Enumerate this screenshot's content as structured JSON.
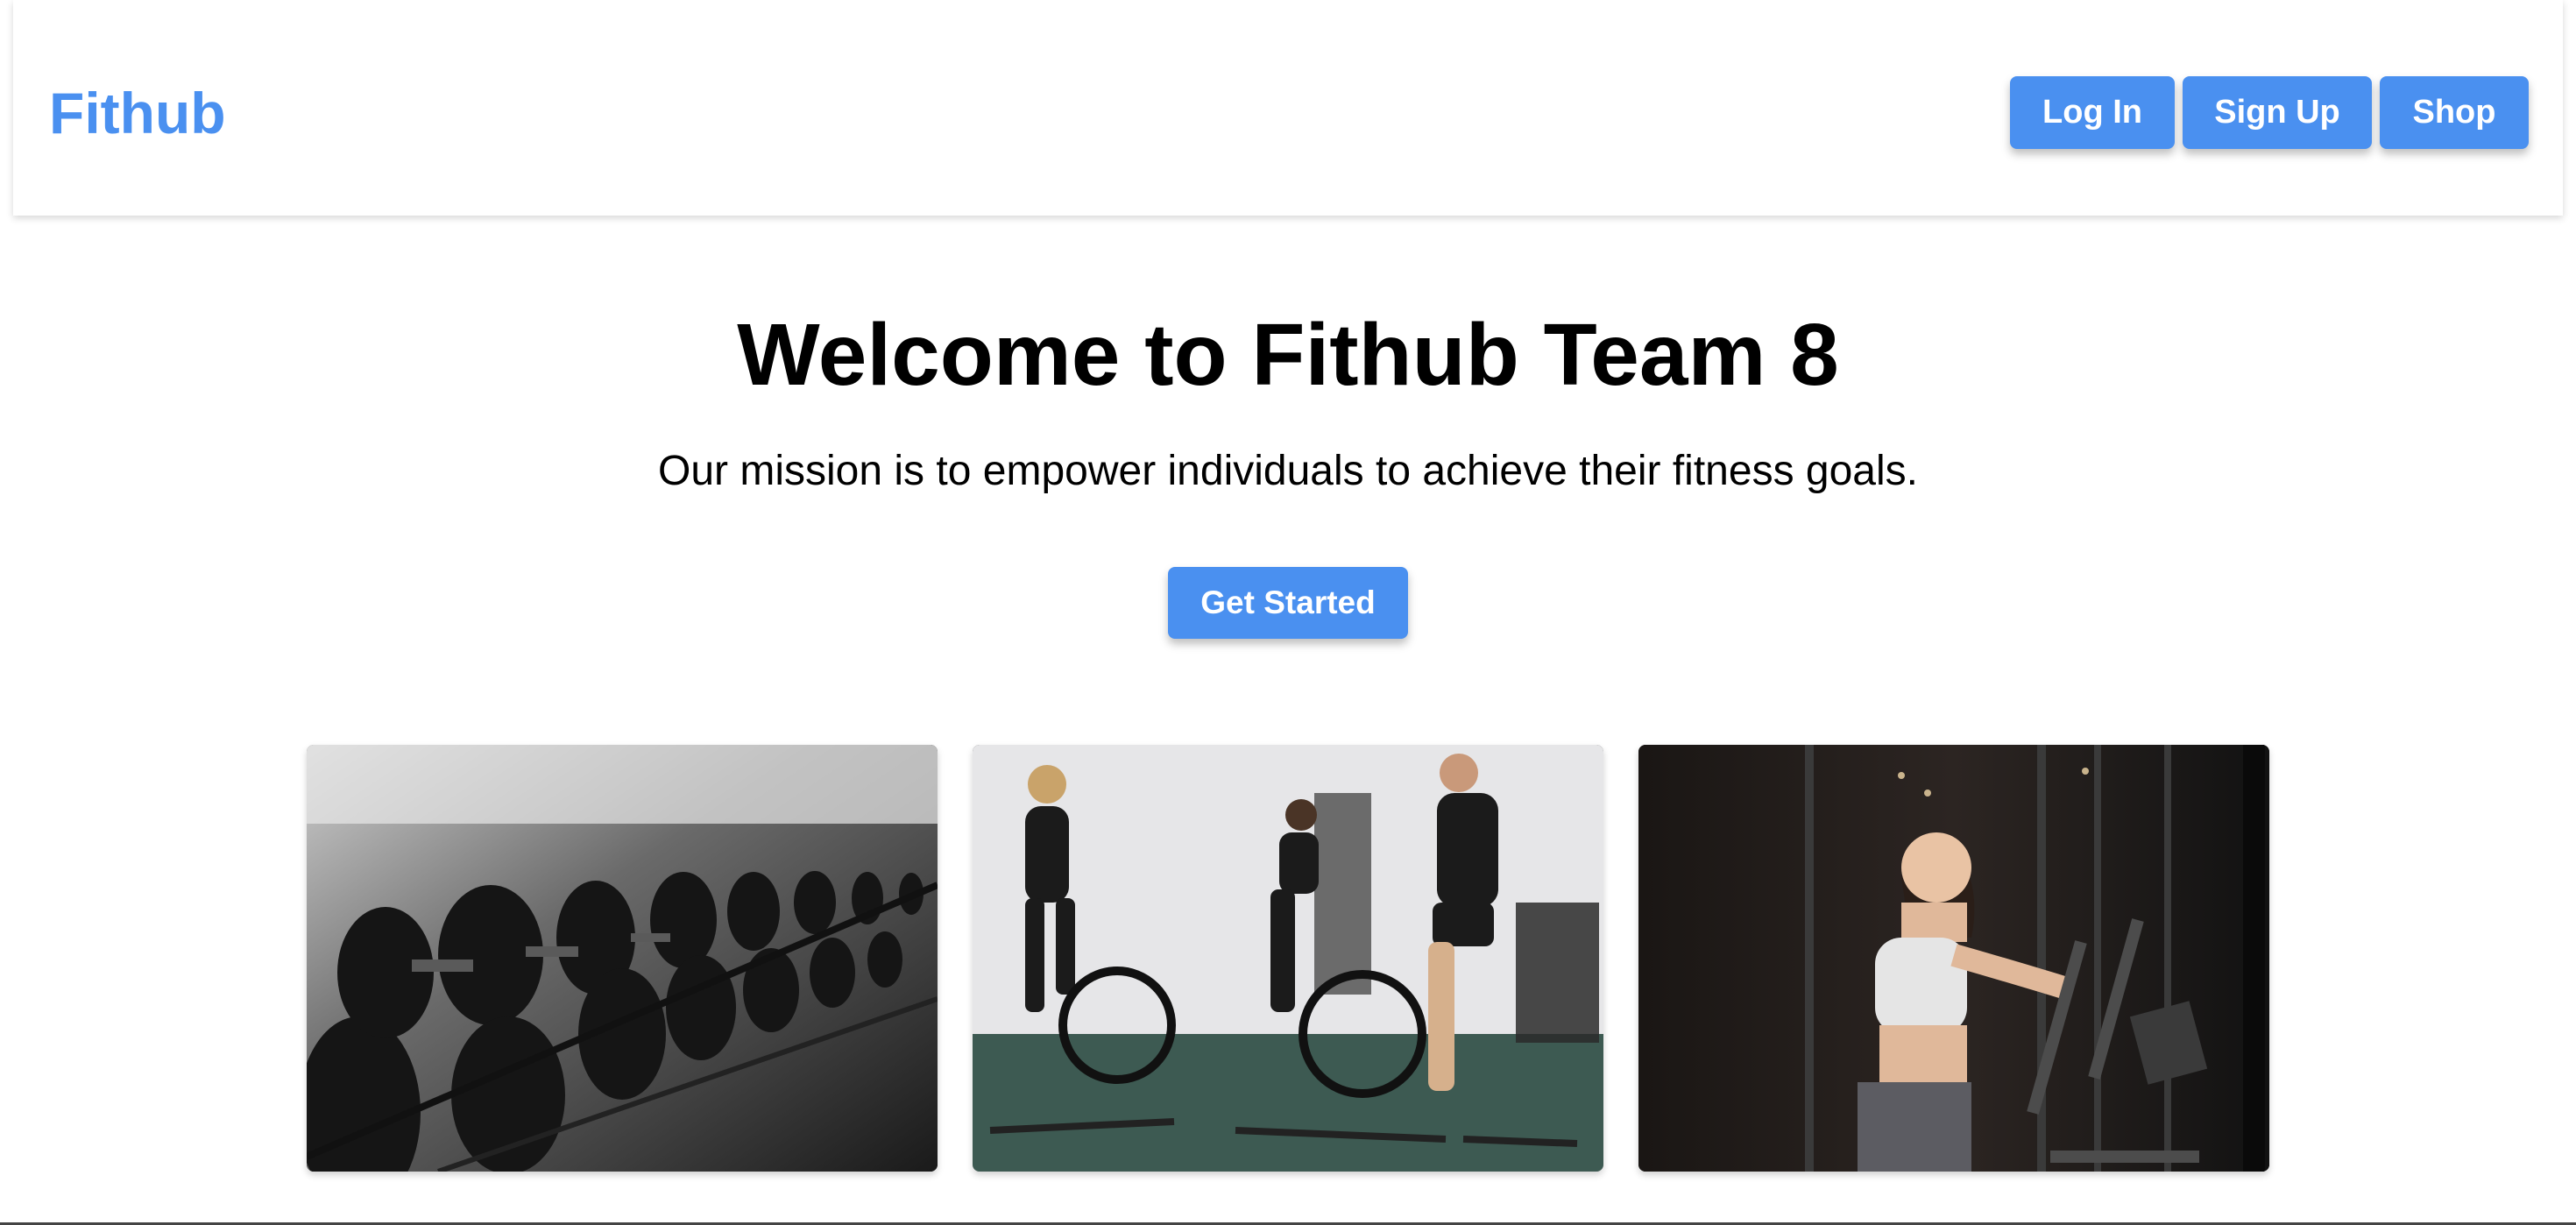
{
  "header": {
    "logo": "Fithub",
    "nav": {
      "login_label": "Log In",
      "signup_label": "Sign Up",
      "shop_label": "Shop"
    }
  },
  "hero": {
    "title": "Welcome to Fithub Team 8",
    "subtitle": "Our mission is to empower individuals to achieve their fitness goals.",
    "cta_label": "Get Started"
  },
  "gallery": [
    {
      "subject": "dumbbell rack"
    },
    {
      "subject": "people on air bikes"
    },
    {
      "subject": "woman on elliptical"
    }
  ],
  "colors": {
    "accent": "#4a90f0",
    "text": "#000000",
    "background": "#ffffff"
  }
}
